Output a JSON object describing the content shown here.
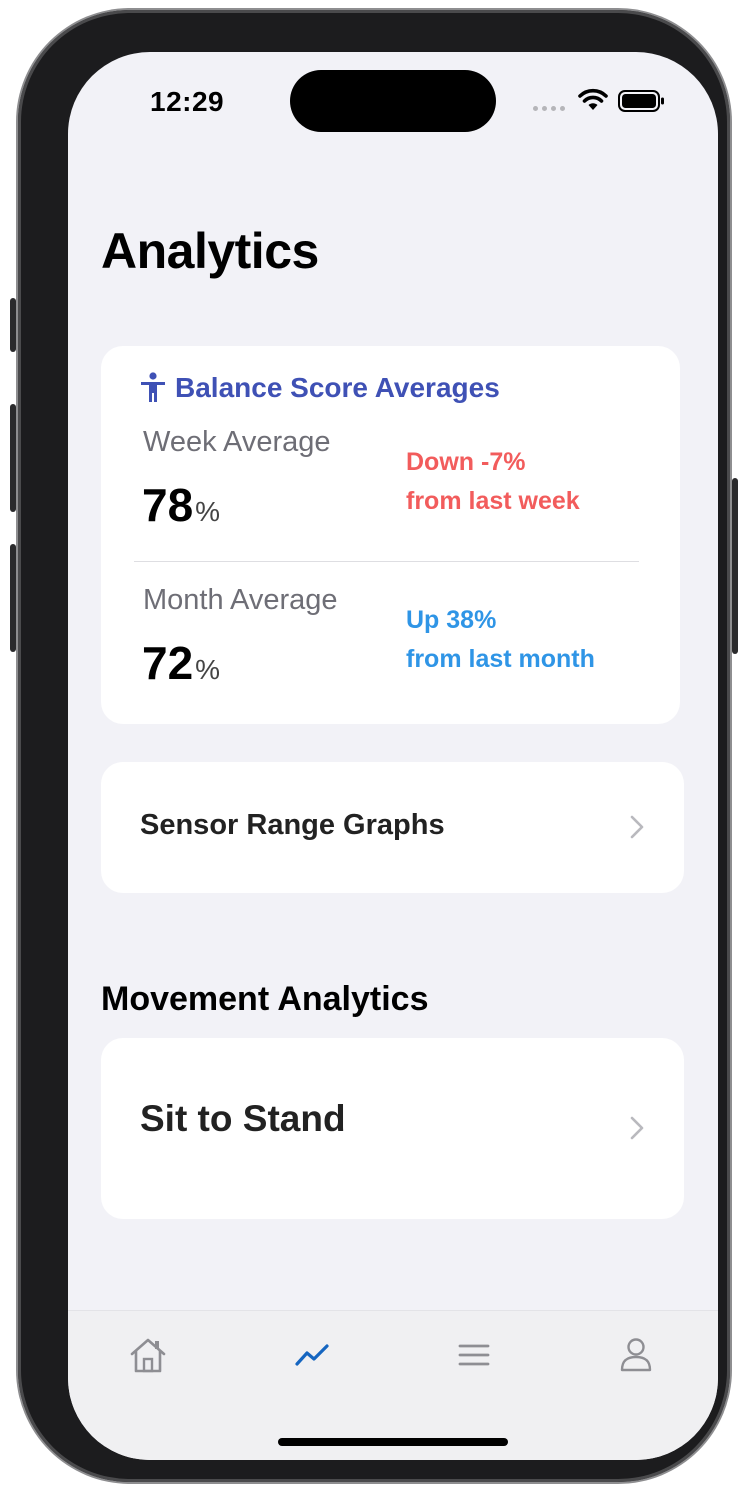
{
  "status_bar": {
    "time": "12:29"
  },
  "page": {
    "title": "Analytics"
  },
  "balance": {
    "header": "Balance Score Averages",
    "week": {
      "label": "Week Average",
      "value": "78",
      "unit": "%",
      "trend_line1": "Down -7%",
      "trend_line2": "from last week"
    },
    "month": {
      "label": "Month Average",
      "value": "72",
      "unit": "%",
      "trend_line1": "Up 38%",
      "trend_line2": "from last month"
    }
  },
  "sensor_row": {
    "label": "Sensor Range Graphs"
  },
  "movement": {
    "section_title": "Movement Analytics",
    "sit_to_stand": {
      "label": "Sit to Stand"
    }
  },
  "tab_bar": {
    "tabs": [
      {
        "icon": "home-icon",
        "active": false
      },
      {
        "icon": "analytics-icon",
        "active": true
      },
      {
        "icon": "menu-icon",
        "active": false
      },
      {
        "icon": "profile-icon",
        "active": false
      }
    ]
  },
  "colors": {
    "accent": "#3f51b5",
    "trend_down": "#f25c5c",
    "trend_up": "#2f95e6",
    "active_tab": "#1565c0",
    "inactive_tab": "#8e8e93"
  }
}
